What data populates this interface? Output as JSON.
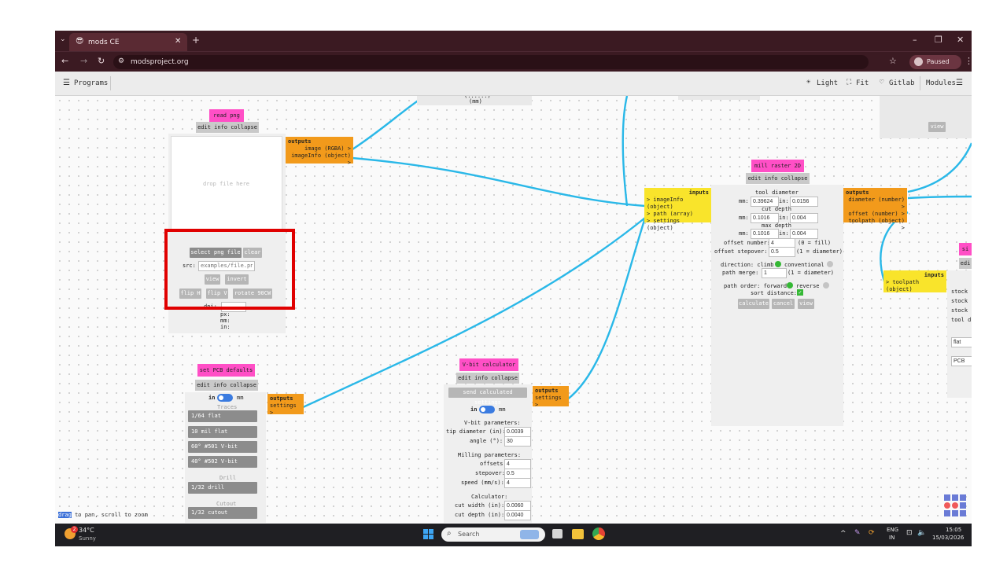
{
  "browser": {
    "tab_title": "mods CE",
    "url": "modsproject.org",
    "profile_label": "Paused",
    "colors": {
      "frame": "#3b1a22",
      "accent": "#ff4fc6"
    }
  },
  "toolbar": {
    "programs_label": "Programs",
    "light_label": "Light",
    "fit_label": "Fit",
    "gitlab_label": "Gitlab",
    "modules_label": "Modules"
  },
  "top_fragment": {
    "text1": "(......)",
    "text2": "(mm)"
  },
  "read_png": {
    "title": "read png",
    "edit_bar": "edit info collapse",
    "drop_text": "drop file here",
    "outputs_header": "outputs",
    "outputs": [
      "image (RGBA) >",
      "imageInfo (object) >"
    ],
    "select_button": "select png file",
    "clear_button": "clear",
    "src_label": "src:",
    "src_placeholder": "examples/file.png",
    "view_button": "view",
    "invert_button": "invert",
    "flip_h_button": "flip H",
    "flip_v_button": "flip V",
    "rotate_button": "rotate 90CW",
    "dpi_label": "dpi:",
    "px_label": "px:",
    "mm_label": "mm:",
    "in_label": "in:"
  },
  "mill_raster": {
    "title": "mill raster 2D",
    "edit_bar": "edit info collapse",
    "inputs_header": "inputs",
    "inputs": [
      "> imageInfo (object)",
      "> path (array)",
      "> settings (object)"
    ],
    "outputs_header": "outputs",
    "outputs": [
      "diameter (number) >",
      "offset (number) >",
      "toolpath (object) >"
    ],
    "tool_diameter_label": "tool diameter",
    "tool_mm": "0.39624",
    "tool_in": "0.0156",
    "cut_depth_label": "cut depth",
    "cut_mm": "0.1016",
    "cut_in": "0.004",
    "max_depth_label": "max depth",
    "max_mm": "0.1016",
    "max_in": "0.004",
    "mm_label": "mm:",
    "in_label": "in:",
    "offset_number_label": "offset number:",
    "offset_number": "4",
    "offset_number_note": "(0 = fill)",
    "offset_stepover_label": "offset stepover:",
    "offset_stepover": "0.5",
    "offset_stepover_note": "(1 = diameter)",
    "direction_label": "direction: climb",
    "conventional_label": "conventional",
    "path_merge_label": "path merge:",
    "path_merge": "1",
    "path_merge_note": "(1 = diameter)",
    "path_order_label": "path order: forward",
    "reverse_label": "reverse",
    "sort_distance_label": "sort distance:",
    "calculate_button": "calculate",
    "cancel_button": "cancel",
    "view_button": "view"
  },
  "toolpath_input": {
    "header": "inputs",
    "item": "> toolpath (object)"
  },
  "right_panel": {
    "title_fragment": "si",
    "edit_fragment": "edi",
    "lines": [
      "stock",
      "stock",
      "stock",
      "tool d"
    ],
    "field1": "flat",
    "field2": "PCB"
  },
  "top_right_view_button": "view",
  "pcb_defaults": {
    "title": "set PCB defaults",
    "edit_bar": "edit info collapse",
    "outputs_header": "outputs",
    "outputs": [
      "settings >"
    ],
    "unit_in": "in",
    "unit_mm": "mm",
    "traces_label": "Traces",
    "presets_traces": [
      "1/64 flat",
      "10 mil flat",
      "60° #501 V-bit",
      "40° #502 V-bit"
    ],
    "drill_label": "Drill",
    "presets_drill": [
      "1/32 drill"
    ],
    "cutout_label": "Cutout",
    "presets_cutout": [
      "1/32 cutout"
    ]
  },
  "vbit": {
    "title": "V-bit calculator",
    "edit_bar": "edit info collapse",
    "send_button": "send calculated settings",
    "outputs_header": "outputs",
    "outputs": [
      "settings >"
    ],
    "unit_in": "in",
    "unit_mm": "mm",
    "vbit_params_label": "V-bit parameters:",
    "tip_diameter_label": "tip diameter (in):",
    "tip_diameter": "0.0039",
    "angle_label": "angle (°):",
    "angle": "30",
    "milling_params_label": "Milling parameters:",
    "offsets_label": "offsets:",
    "offsets": "4",
    "stepover_label": "stepover:",
    "stepover": "0.5",
    "speed_label": "speed (mm/s):",
    "speed": "4",
    "calculator_label": "Calculator:",
    "cut_width_label": "cut width (in):",
    "cut_width": "0.0060",
    "cut_depth_label": "cut depth (in):",
    "cut_depth": "0.0040"
  },
  "status": {
    "highlight": "drag",
    "text": "to pan, scroll to zoom"
  },
  "taskbar": {
    "temperature": "34°C",
    "weather": "Sunny",
    "search_placeholder": "Search",
    "language": "ENG",
    "region": "IN",
    "time": "15:05",
    "date": "15/03/2026",
    "badge": "2"
  },
  "colors": {
    "module_title": "#ff4fc6",
    "outputs": "#f29a1b",
    "inputs": "#f9e42b",
    "wire": "#2ab8e8",
    "highlight_box": "#e00000"
  }
}
